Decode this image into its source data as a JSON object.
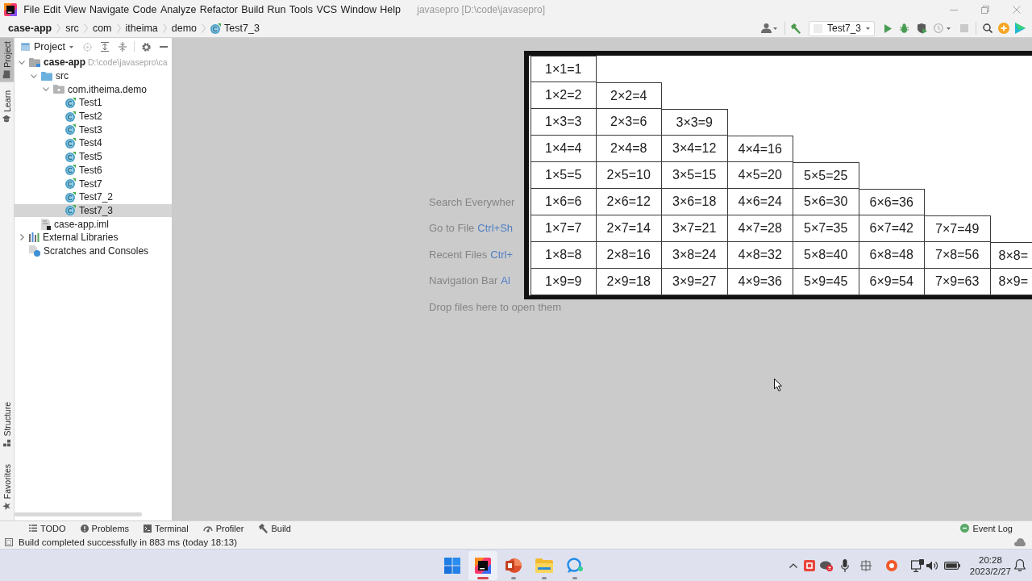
{
  "window": {
    "title": "javasepro [D:\\code\\javasepro]"
  },
  "menu": [
    "File",
    "Edit",
    "View",
    "Navigate",
    "Code",
    "Analyze",
    "Refactor",
    "Build",
    "Run",
    "Tools",
    "VCS",
    "Window",
    "Help"
  ],
  "breadcrumb": [
    {
      "label": "case-app",
      "kind": "module"
    },
    {
      "label": "src",
      "kind": "folder"
    },
    {
      "label": "com",
      "kind": "folder"
    },
    {
      "label": "itheima",
      "kind": "folder"
    },
    {
      "label": "demo",
      "kind": "folder"
    },
    {
      "label": "Test7_3",
      "kind": "class"
    }
  ],
  "toolbar": {
    "run_configuration": "Test7_3"
  },
  "tool_strip": {
    "top": [
      {
        "label": "Project",
        "kind": "project",
        "selected": true
      },
      {
        "label": "Learn",
        "kind": "learn",
        "selected": false
      }
    ],
    "bottom": [
      {
        "label": "Structure",
        "kind": "structure",
        "selected": false
      },
      {
        "label": "Favorites",
        "kind": "favorites",
        "selected": false
      }
    ]
  },
  "project_panel": {
    "title": "Project",
    "tree": [
      {
        "label": "case-app",
        "kind": "module",
        "path": "D:\\code\\javasepro\\ca",
        "expanded": true,
        "selected": false,
        "children": [
          {
            "label": "src",
            "kind": "source-folder",
            "expanded": true,
            "selected": false,
            "children": [
              {
                "label": "com.itheima.demo",
                "kind": "package",
                "expanded": true,
                "selected": false,
                "children": [
                  {
                    "label": "Test1",
                    "kind": "class",
                    "selected": false
                  },
                  {
                    "label": "Test2",
                    "kind": "class",
                    "selected": false
                  },
                  {
                    "label": "Test3",
                    "kind": "class",
                    "selected": false
                  },
                  {
                    "label": "Test4",
                    "kind": "class",
                    "selected": false
                  },
                  {
                    "label": "Test5",
                    "kind": "class",
                    "selected": false
                  },
                  {
                    "label": "Test6",
                    "kind": "class",
                    "selected": false
                  },
                  {
                    "label": "Test7",
                    "kind": "class",
                    "selected": false
                  },
                  {
                    "label": "Test7_2",
                    "kind": "class",
                    "selected": false
                  },
                  {
                    "label": "Test7_3",
                    "kind": "class",
                    "selected": true
                  }
                ]
              }
            ]
          },
          {
            "label": "case-app.iml",
            "kind": "iml-file",
            "selected": false
          }
        ]
      },
      {
        "label": "External Libraries",
        "kind": "libraries",
        "expanded": false,
        "selected": false
      },
      {
        "label": "Scratches and Consoles",
        "kind": "scratches",
        "selected": false
      }
    ]
  },
  "editor": {
    "hints": [
      {
        "label": "Search Everywher"
      },
      {
        "label": "Go to File",
        "shortcut": "Ctrl+Sh"
      },
      {
        "label": "Recent Files",
        "shortcut": "Ctrl+"
      },
      {
        "label": "Navigation Bar",
        "shortcut": "Al"
      },
      {
        "label": "Drop files here to open them"
      }
    ]
  },
  "overlay_table": {
    "rows": [
      [
        "1×1=1"
      ],
      [
        "1×2=2",
        "2×2=4"
      ],
      [
        "1×3=3",
        "2×3=6",
        "3×3=9"
      ],
      [
        "1×4=4",
        "2×4=8",
        "3×4=12",
        "4×4=16"
      ],
      [
        "1×5=5",
        "2×5=10",
        "3×5=15",
        "4×5=20",
        "5×5=25"
      ],
      [
        "1×6=6",
        "2×6=12",
        "3×6=18",
        "4×6=24",
        "5×6=30",
        "6×6=36"
      ],
      [
        "1×7=7",
        "2×7=14",
        "3×7=21",
        "4×7=28",
        "5×7=35",
        "6×7=42",
        "7×7=49"
      ],
      [
        "1×8=8",
        "2×8=16",
        "3×8=24",
        "4×8=32",
        "5×8=40",
        "6×8=48",
        "7×8=56",
        "8×8="
      ],
      [
        "1×9=9",
        "2×9=18",
        "3×9=27",
        "4×9=36",
        "5×9=45",
        "6×9=54",
        "7×9=63",
        "8×9="
      ]
    ]
  },
  "tool_windows": [
    {
      "label": "TODO",
      "kind": "todo",
      "selected": false
    },
    {
      "label": "Problems",
      "kind": "problems",
      "selected": false
    },
    {
      "label": "Terminal",
      "kind": "terminal",
      "selected": false
    },
    {
      "label": "Profiler",
      "kind": "profiler",
      "selected": false
    },
    {
      "label": "Build",
      "kind": "build",
      "selected": false
    }
  ],
  "event_log": {
    "label": "Event Log"
  },
  "status_bar": {
    "message": "Build completed successfully in 883 ms (today 18:13)"
  },
  "taskbar": {
    "apps": [
      {
        "kind": "start",
        "running": false,
        "active": false
      },
      {
        "kind": "ide",
        "running": true,
        "active": true
      },
      {
        "kind": "presentation",
        "running": true,
        "active": false
      },
      {
        "kind": "explorer",
        "running": true,
        "active": false
      },
      {
        "kind": "chat",
        "running": true,
        "active": false
      }
    ],
    "clock": {
      "time": "20:28",
      "date": "2023/2/27"
    }
  }
}
